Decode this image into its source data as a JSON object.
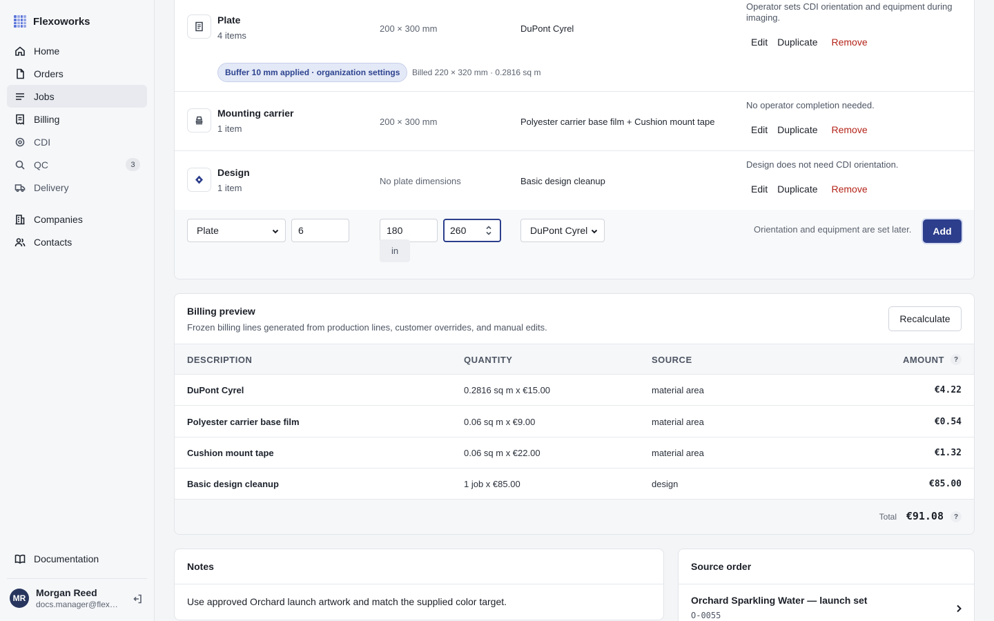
{
  "app": {
    "name": "Flexoworks",
    "accent": "#2c3e8c"
  },
  "sidebar": {
    "items": [
      {
        "label": "Home",
        "icon": "home-icon"
      },
      {
        "label": "Orders",
        "icon": "file-icon"
      },
      {
        "label": "Jobs",
        "icon": "list-icon",
        "active": true
      },
      {
        "label": "Billing",
        "icon": "receipt-icon"
      },
      {
        "label": "CDI",
        "icon": "target-icon"
      },
      {
        "label": "QC",
        "icon": "search-icon",
        "badge": "3"
      },
      {
        "label": "Delivery",
        "icon": "truck-icon"
      },
      {
        "label": "Companies",
        "icon": "building-icon"
      },
      {
        "label": "Contacts",
        "icon": "users-icon"
      }
    ],
    "documentation": "Documentation",
    "user": {
      "initials": "MR",
      "name": "Morgan Reed",
      "email": "docs.manager@flexoworks.example"
    }
  },
  "lines": [
    {
      "title": "Plate",
      "count": "4 items",
      "dims": "200 × 300 mm",
      "material": "DuPont Cyrel",
      "note": "Operator sets CDI orientation and equipment during imaging.",
      "buffer": "Buffer 10 mm applied · organization settings",
      "billed": "Billed 220 × 320 mm · 0.2816 sq m"
    },
    {
      "title": "Mounting carrier",
      "count": "1 item",
      "dims": "200 × 300 mm",
      "material": "Polyester carrier base film + Cushion mount tape",
      "note": "No operator completion needed."
    },
    {
      "title": "Design",
      "count": "1 item",
      "dims": "No plate dimensions",
      "material": "Basic design cleanup",
      "note": "Design does not need CDI orientation."
    }
  ],
  "actions": {
    "edit": "Edit",
    "duplicate": "Duplicate",
    "remove": "Remove"
  },
  "new_line": {
    "type": "Plate",
    "quantity": "6",
    "width": "180",
    "height": "260",
    "unit": "in",
    "material": "DuPont Cyrel",
    "hint": "Orientation and equipment are set later.",
    "add": "Add"
  },
  "billing": {
    "title": "Billing preview",
    "subtitle": "Frozen billing lines generated from production lines, customer overrides, and manual edits.",
    "recalculate": "Recalculate",
    "columns": [
      "DESCRIPTION",
      "QUANTITY",
      "SOURCE",
      "AMOUNT"
    ],
    "help": "?",
    "rows": [
      {
        "desc": "DuPont Cyrel",
        "qty": "0.2816 sq m x €15.00",
        "source": "material area",
        "amount": "€4.22"
      },
      {
        "desc": "Polyester carrier base film",
        "qty": "0.06 sq m x €9.00",
        "source": "material area",
        "amount": "€0.54"
      },
      {
        "desc": "Cushion mount tape",
        "qty": "0.06 sq m x €22.00",
        "source": "material area",
        "amount": "€1.32"
      },
      {
        "desc": "Basic design cleanup",
        "qty": "1 job x €85.00",
        "source": "design",
        "amount": "€85.00"
      }
    ],
    "total_label": "Total",
    "total": "€91.08"
  },
  "notes": {
    "title": "Notes",
    "text": "Use approved Orchard launch artwork and match the supplied color target."
  },
  "source_order": {
    "title": "Source order",
    "name": "Orchard Sparkling Water — launch set",
    "id": "O-0055"
  }
}
